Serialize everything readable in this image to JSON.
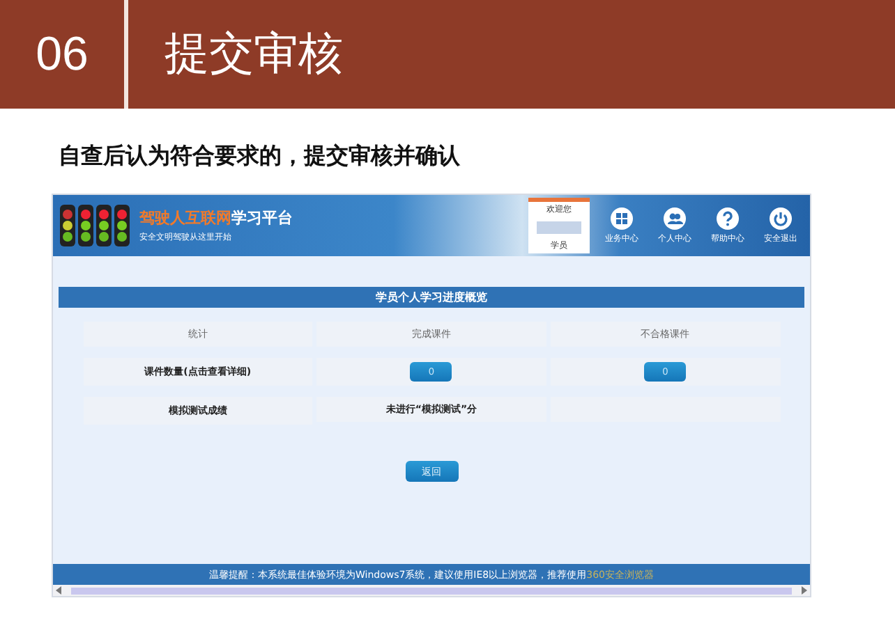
{
  "slide": {
    "number": "06",
    "title": "提交审核",
    "subtitle": "自查后认为符合要求的，提交审核并确认"
  },
  "app": {
    "logo": {
      "title_accent": "驾驶人互联网",
      "title_rest": "学习平台",
      "tagline": "安全文明驾驶从这里开始"
    },
    "welcome": {
      "greeting": "欢迎您",
      "role": "学员"
    },
    "nav": [
      {
        "kind": "grid",
        "label": "业务中心"
      },
      {
        "kind": "people",
        "label": "个人中心"
      },
      {
        "kind": "help",
        "label": "帮助中心"
      },
      {
        "kind": "power",
        "label": "安全退出"
      }
    ],
    "table": {
      "title": "学员个人学习进度概览",
      "columns": [
        "统计",
        "完成课件",
        "不合格课件"
      ],
      "rows": [
        {
          "cells": [
            {
              "kind": "label",
              "text": "课件数量(点击查看详细)"
            },
            {
              "kind": "button",
              "text": "0"
            },
            {
              "kind": "button",
              "text": "0"
            }
          ]
        },
        {
          "cells": [
            {
              "kind": "label",
              "text": "模拟测试成绩"
            },
            {
              "kind": "text",
              "text": "未进行“模拟测试”分"
            },
            {
              "kind": "empty"
            }
          ]
        }
      ]
    },
    "back_button": "返回",
    "footer": {
      "notice": "温馨提醒：本系统最佳体验环境为Windows7系统，建议使用IE8以上浏览器，推荐使用",
      "link": "360安全浏览器"
    }
  }
}
